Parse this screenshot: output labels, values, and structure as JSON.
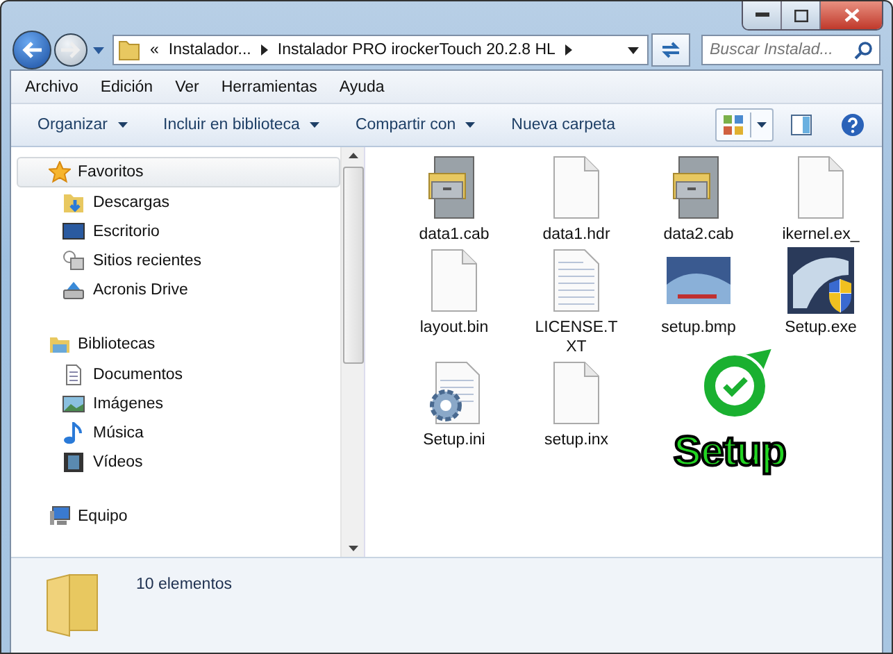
{
  "address": {
    "crumbs": [
      "«",
      "Instalador...",
      "Instalador PRO irockerTouch 20.2.8 HL"
    ]
  },
  "search": {
    "placeholder": "Buscar Instalad..."
  },
  "menu": [
    "Archivo",
    "Edición",
    "Ver",
    "Herramientas",
    "Ayuda"
  ],
  "toolbar": [
    {
      "label": "Organizar",
      "has_menu": true
    },
    {
      "label": "Incluir en biblioteca",
      "has_menu": true
    },
    {
      "label": "Compartir con",
      "has_menu": true
    },
    {
      "label": "Nueva carpeta",
      "has_menu": false
    }
  ],
  "sidebar": [
    {
      "label": "Favoritos",
      "kind": "star",
      "selected": true,
      "children": [
        {
          "label": "Descargas",
          "kind": "downloads"
        },
        {
          "label": "Escritorio",
          "kind": "desktop"
        },
        {
          "label": "Sitios recientes",
          "kind": "recent"
        },
        {
          "label": "Acronis Drive",
          "kind": "drive"
        }
      ]
    },
    {
      "label": "Bibliotecas",
      "kind": "library",
      "selected": false,
      "children": [
        {
          "label": "Documentos",
          "kind": "documents"
        },
        {
          "label": "Imágenes",
          "kind": "pictures"
        },
        {
          "label": "Música",
          "kind": "music"
        },
        {
          "label": "Vídeos",
          "kind": "videos"
        }
      ]
    },
    {
      "label": "Equipo",
      "kind": "computer",
      "selected": false
    }
  ],
  "files": [
    {
      "name": "data1.cab",
      "kind": "cabinet"
    },
    {
      "name": "data1.hdr",
      "kind": "blank"
    },
    {
      "name": "data2.cab",
      "kind": "cabinet"
    },
    {
      "name": "ikernel.ex_",
      "kind": "blank"
    },
    {
      "name": "layout.bin",
      "kind": "blank"
    },
    {
      "name": "LICENSE.TXT",
      "kind": "text"
    },
    {
      "name": "setup.bmp",
      "kind": "image"
    },
    {
      "name": "Setup.exe",
      "kind": "installer"
    },
    {
      "name": "Setup.ini",
      "kind": "config"
    },
    {
      "name": "setup.inx",
      "kind": "blank"
    }
  ],
  "status_bar": {
    "count": "10 elementos"
  },
  "annotation": {
    "label": "Setup"
  }
}
